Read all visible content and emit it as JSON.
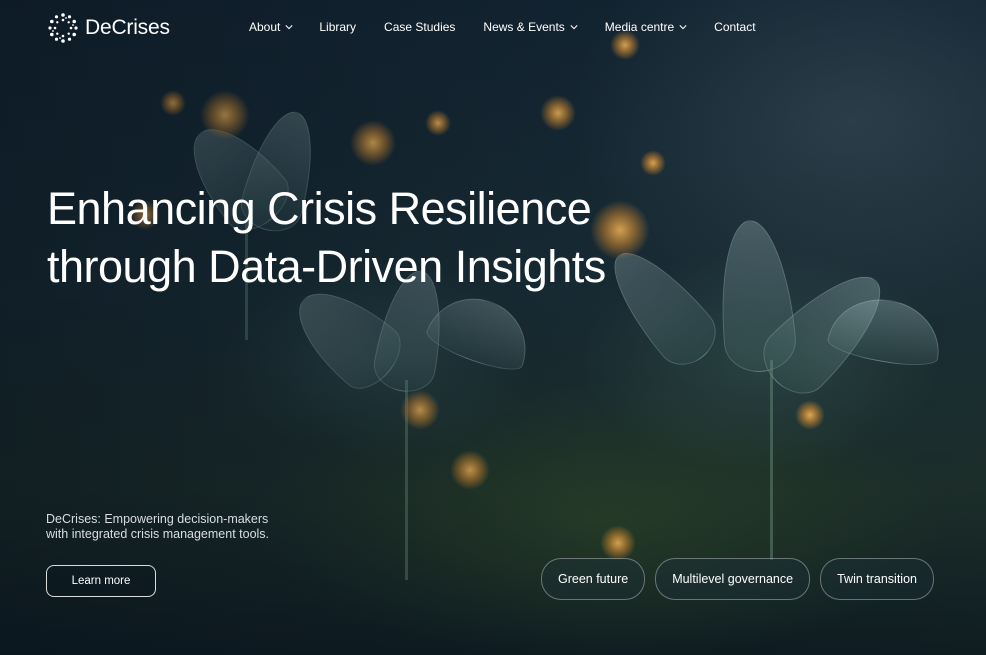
{
  "brand": {
    "name": "DeCrises",
    "logo_icon": "dotted-ring-logo"
  },
  "nav": [
    {
      "label": "About",
      "has_dropdown": true
    },
    {
      "label": "Library",
      "has_dropdown": false
    },
    {
      "label": "Case Studies",
      "has_dropdown": false
    },
    {
      "label": "News & Events",
      "has_dropdown": true
    },
    {
      "label": "Media centre",
      "has_dropdown": true
    },
    {
      "label": "Contact",
      "has_dropdown": false
    }
  ],
  "hero": {
    "title_line1": "Enhancing Crisis Resilience",
    "title_line2": "through Data-Driven Insights",
    "tagline": "DeCrises: Empowering decision-makers with integrated crisis management tools.",
    "cta_label": "Learn more"
  },
  "tags": [
    "Green future",
    "Multilevel governance",
    "Twin transition"
  ],
  "colors": {
    "background": "#0b1a26",
    "text": "#ffffff"
  }
}
